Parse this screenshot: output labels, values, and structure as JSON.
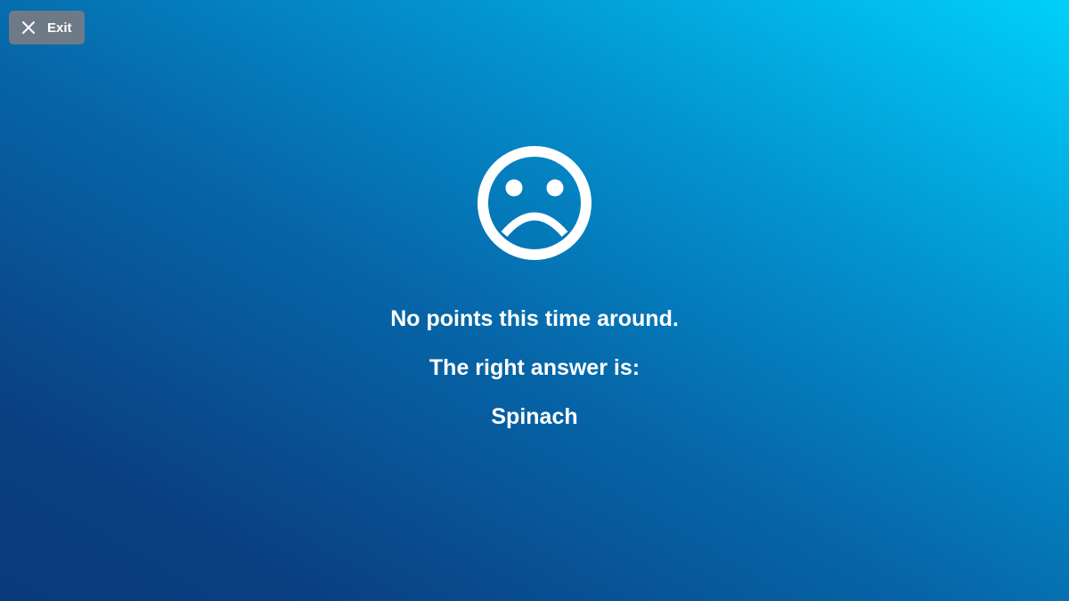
{
  "header": {
    "exit_label": "Exit",
    "exit_icon": "close-icon"
  },
  "result": {
    "icon": "sad-face-icon",
    "message": "No points this time around.",
    "answer_prompt": "The right answer is:",
    "answer": "Spinach"
  },
  "colors": {
    "gradient_dark": "#0a3a7a",
    "gradient_light": "#00d0fb",
    "exit_button_bg": "#6f7a87",
    "text": "#ffffff"
  }
}
